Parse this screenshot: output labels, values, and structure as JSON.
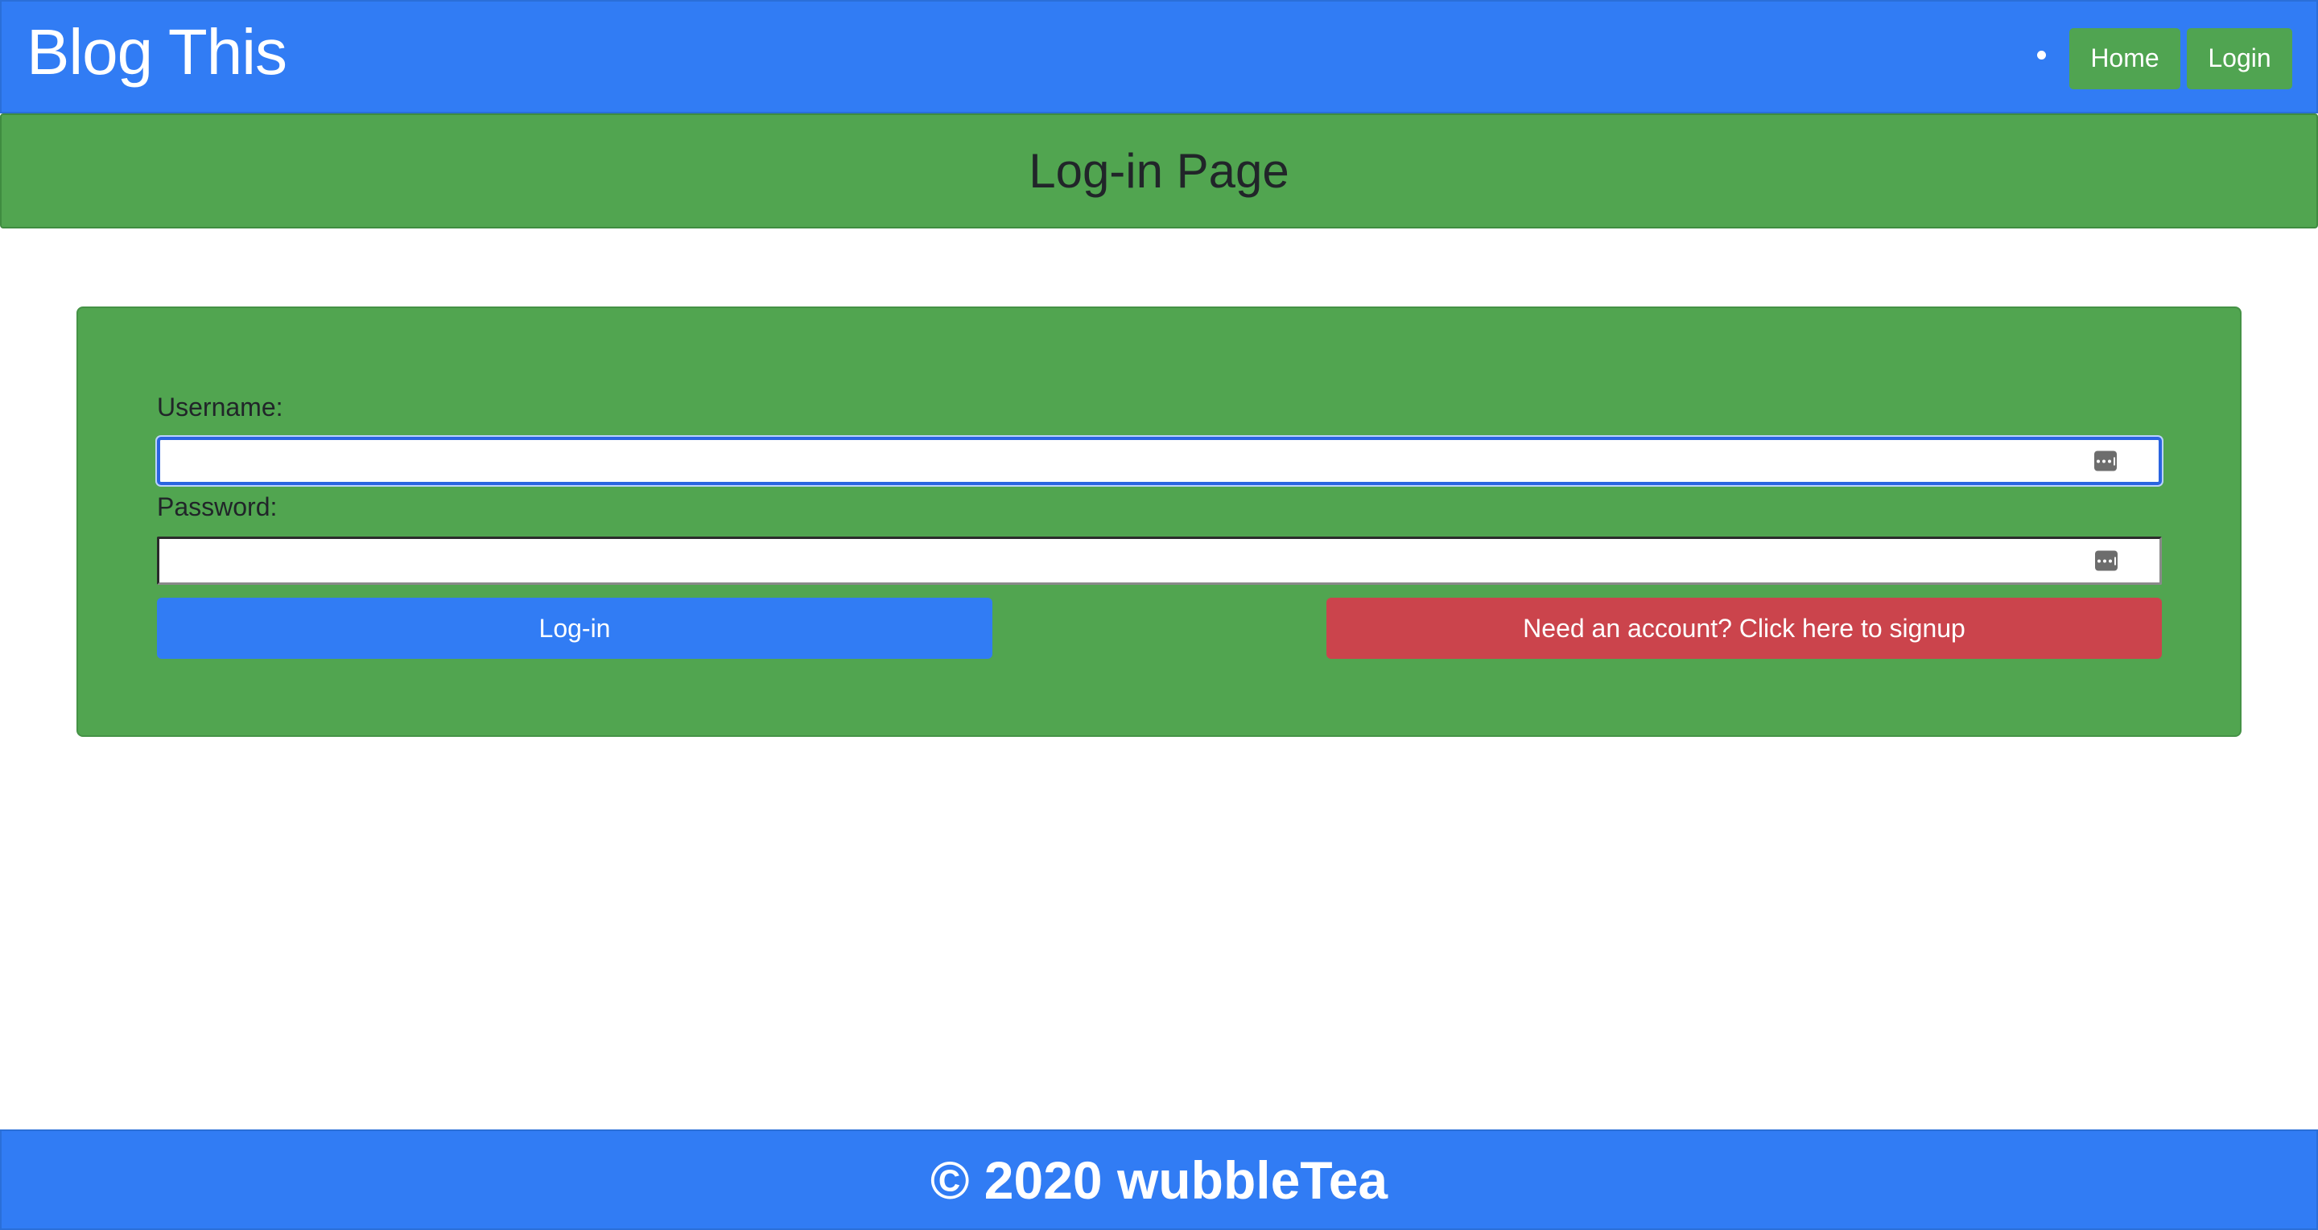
{
  "navbar": {
    "brand": "Blog This",
    "nav_links": {
      "home": "Home",
      "login": "Login"
    }
  },
  "header": {
    "title": "Log-in Page"
  },
  "login_form": {
    "username_label": "Username:",
    "username_value": "",
    "password_label": "Password:",
    "password_value": "",
    "login_button": "Log-in",
    "signup_button": "Need an account? Click here to signup",
    "field_icon": "password-manager-key-icon"
  },
  "footer": {
    "text": "© 2020 wubbleTea"
  },
  "colors": {
    "primary": "#317cf4",
    "success": "#51a550",
    "danger": "#cb444c",
    "text_dark": "#212529"
  }
}
